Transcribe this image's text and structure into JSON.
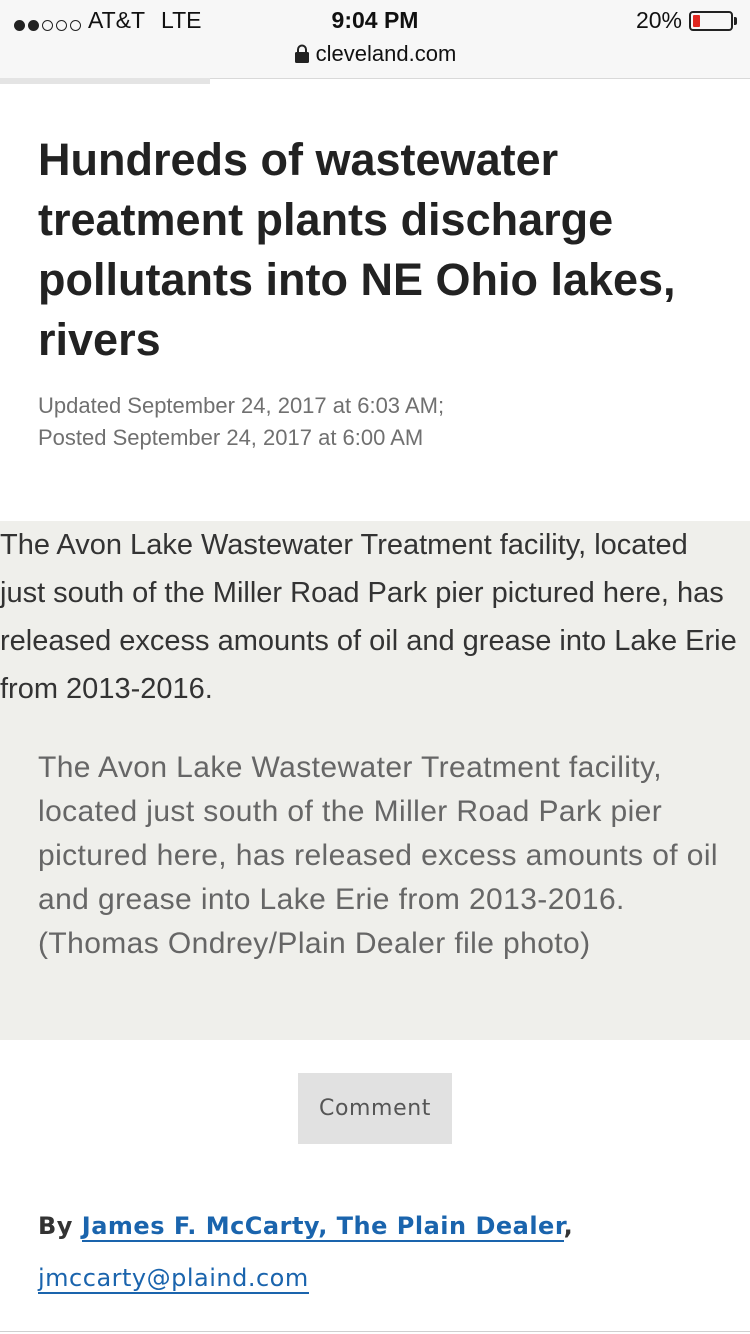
{
  "status_bar": {
    "signal_bars_filled": 2,
    "signal_bars_total": 5,
    "carrier": "AT&T",
    "network": "LTE",
    "time": "9:04 PM",
    "battery_percent_label": "20%",
    "battery_level": 0.2,
    "battery_color": "#e0261f"
  },
  "browser": {
    "url": "cleveland.com",
    "lock_icon": "lock-icon",
    "load_progress": 0.28
  },
  "article": {
    "headline": "Hundreds of wastewater treatment plants discharge pollutants into NE Ohio lakes, rivers",
    "updated": "Updated September 24, 2017 at 6:03 AM;",
    "posted": "Posted September 24, 2017 at 6:00 AM",
    "image_alt": "The Avon Lake Wastewater Treatment facility, located just south of the Miller Road Park pier pictured here, has released excess amounts of oil and grease into Lake Erie from 2013-2016.",
    "caption": "The Avon Lake Wastewater Treatment facility, located just south of the Miller Road Park pier pictured here, has released excess amounts of oil and grease into Lake Erie from 2013-2016.(Thomas Ondrey/Plain Dealer file photo)",
    "comment_label": "Comment",
    "byline_prefix": "By",
    "author": "James F. McCarty, The Plain Dealer",
    "byline_separator": ",",
    "email": "jmccarty@plaind.com"
  },
  "colors": {
    "link": "#1a64ad",
    "media_background": "#efefeb",
    "headline": "#222222"
  }
}
